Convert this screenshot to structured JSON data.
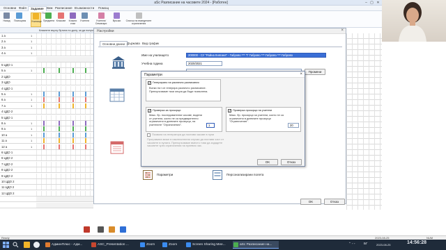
{
  "window": {
    "title": "aSc Разписание на часовете 2024 - [Работен]",
    "buttons": [
      "–",
      "▢",
      "✕"
    ]
  },
  "menu": [
    "Основни",
    "Файл",
    "Задание",
    "Виж",
    "Разписание",
    "Възможности",
    "Помощ"
  ],
  "menu_active": 2,
  "ribbon": [
    {
      "label": "Назад",
      "color": "#7a8aa5"
    },
    {
      "label": "Помощник",
      "color": "#5a9bd5"
    },
    {
      "label": "Училище",
      "color": "#f0b429"
    },
    {
      "label": "Предмети",
      "color": "#4caf50"
    },
    {
      "label": "Класове",
      "color": "#e57373"
    },
    {
      "label": "Класни стаи",
      "color": "#8e6bbf"
    },
    {
      "label": "Учители",
      "color": "#6d8fb3"
    },
    {
      "label": "Учители/ Семинари",
      "color": "#d47fa6"
    },
    {
      "label": "Връзки",
      "color": "#9c7ccf"
    },
    {
      "label": "Списък на въведените ограничения",
      "color": "#c0c0c0"
    }
  ],
  "ribbon_active": 2,
  "ribbon_group_label": "Помощ",
  "grid": {
    "header_hint": "Кликнете върху бутона по-долу, за да получите",
    "rows": [
      {
        "cls": "1 а",
        "sub": "1",
        "bar": ""
      },
      {
        "cls": "2 а",
        "sub": "1",
        "bar": ""
      },
      {
        "cls": "3 а",
        "sub": "1",
        "bar": ""
      },
      {
        "cls": "4 а",
        "sub": "1",
        "bar": ""
      },
      {
        "cls": "",
        "sub": "",
        "bar": ""
      },
      {
        "cls": "5 ЦДО 1",
        "sub": "",
        "bar": ""
      },
      {
        "cls": "5 а",
        "sub": "1",
        "bar": "#4caf50"
      },
      {
        "cls": "2 ЦДО",
        "sub": "",
        "bar": ""
      },
      {
        "cls": "3 ЦДО",
        "sub": "",
        "bar": ""
      },
      {
        "cls": "4 ЦДО 1",
        "sub": "",
        "bar": ""
      },
      {
        "cls": "5 а",
        "sub": "1",
        "bar": "#5a9bd5"
      },
      {
        "cls": "6 а",
        "sub": "1",
        "bar": "#e57373"
      },
      {
        "cls": "7 а",
        "sub": "1",
        "bar": "#f0b429"
      },
      {
        "cls": "4 ЦДО 2",
        "sub": "",
        "bar": ""
      },
      {
        "cls": "5 ЦДО 1",
        "sub": "",
        "bar": ""
      },
      {
        "cls": "8 а",
        "sub": "1",
        "bar": "#8e6bbf"
      },
      {
        "cls": "9 а",
        "sub": "1",
        "bar": "#4caf50"
      },
      {
        "cls": "10 а",
        "sub": "1",
        "bar": "#5a9bd5"
      },
      {
        "cls": "11 а",
        "sub": "1",
        "bar": "#f0b429"
      },
      {
        "cls": "12 а",
        "sub": "1",
        "bar": "#e57373"
      },
      {
        "cls": "6 ЦДО 1",
        "sub": "",
        "bar": ""
      },
      {
        "cls": "6 ЦДО 2",
        "sub": "",
        "bar": ""
      },
      {
        "cls": "7 ЦДО 2",
        "sub": "",
        "bar": ""
      },
      {
        "cls": "8 ЦДО 2",
        "sub": "",
        "bar": ""
      },
      {
        "cls": "9 ЦДО 2",
        "sub": "",
        "bar": ""
      },
      {
        "cls": "10 ЦДО 2",
        "sub": "",
        "bar": ""
      },
      {
        "cls": "11 ЦДО 2",
        "sub": "",
        "bar": ""
      },
      {
        "cls": "12 ЦДО 2",
        "sub": "",
        "bar": ""
      },
      {
        "cls": "",
        "sub": "",
        "bar": ""
      },
      {
        "cls": "",
        "sub": "",
        "bar": ""
      }
    ]
  },
  "settings": {
    "title": "Настройки",
    "tabs": [
      "Основни данни",
      "Държава",
      "Вид график"
    ],
    "tab_active": 0,
    "school_name_label": "Име на училището",
    "school_name_value": "200000 - СУ \"Райна Княгиня\" - Габрово *** \"Г Габрово *** Габрово *** Габрово",
    "school_year_label": "Учебна година",
    "school_year_value": "2020/2021",
    "row3_value": "",
    "change_button": "Промени",
    "parameters_label": "Параметри",
    "custom_fields_label": "Персонализирани полета",
    "ok": "OK",
    "cancel": "Отказ"
  },
  "params": {
    "title": "Параметри",
    "cb1_label": "Генерирано на различни разписания",
    "cb1_text": "Всеки път се генерира различно разписание. Препоръчваме тази опция да бъде позволена.",
    "cb2_label": "Проверка за прозорци",
    "cb2_text": "Макс. бр. последователни часове, водени от учители, които не са предварително ограничени в дневните прозорци, на учителите \"Ограничения\".",
    "cb2_value": "1",
    "cb3_label": "Проверка прозорци на учители",
    "cb3_text": "Макс. бр. прозорци за учители, които не са ограничени в дневните прозорци \"Ограничения\".",
    "cb3_value": "20",
    "cb4_label": "Позволи на генератора да поставя часове в нули",
    "cb4_text": "Програмата може в изключителни случаи да поставя част от часовете в нулата. Препоръчваме вместо това да зададете часовете чрез ограничения на нулевия час.",
    "ok": "OK",
    "cancel": "Отказ"
  },
  "status": {
    "left": "Ready",
    "mid": "2023-08-25",
    "right": "NUM"
  },
  "taskbar": {
    "items": [
      {
        "label": "АдминПлюс - Адм...",
        "color": "#e07b2f"
      },
      {
        "label": "ASC_Presentation ...",
        "color": "#c8472f"
      },
      {
        "label": "Zoom",
        "color": "#3b8cf0"
      },
      {
        "label": "Zoom",
        "color": "#3b8cf0"
      },
      {
        "label": "Screen Sharing Mee...",
        "color": "#3b8cf0"
      },
      {
        "label": "aSc Разписание на...",
        "color": "#4caf50"
      }
    ],
    "active_index": 5,
    "tray_lang": "БГ",
    "clock": "14:56:28",
    "date": "2023-08-25"
  }
}
